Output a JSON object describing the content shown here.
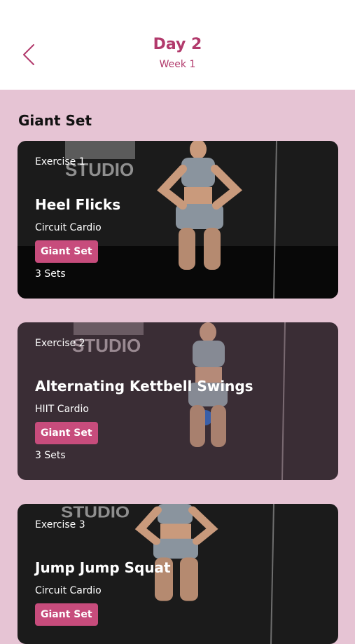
{
  "header": {
    "title": "Day 2",
    "subtitle": "Week 1"
  },
  "section": {
    "title": "Giant Set"
  },
  "exercises": [
    {
      "number_label": "Exercise 1",
      "name": "Heel Flicks",
      "type": "Circuit Cardio",
      "tag": "Giant Set",
      "sets": "3 Sets"
    },
    {
      "number_label": "Exercise 2",
      "name": "Alternating Kettbell Swings",
      "type": "HIIT Cardio",
      "tag": "Giant Set",
      "sets": "3 Sets"
    },
    {
      "number_label": "Exercise 3",
      "name": "Jump Jump Squat",
      "type": "Circuit Cardio",
      "tag": "Giant Set",
      "sets": ""
    }
  ],
  "background_text": "STUDIO",
  "colors": {
    "accent": "#b23a6c",
    "tag": "#c74c7c",
    "page_background": "#e6c4d4"
  },
  "icons": {
    "back": "chevron-left-icon"
  }
}
